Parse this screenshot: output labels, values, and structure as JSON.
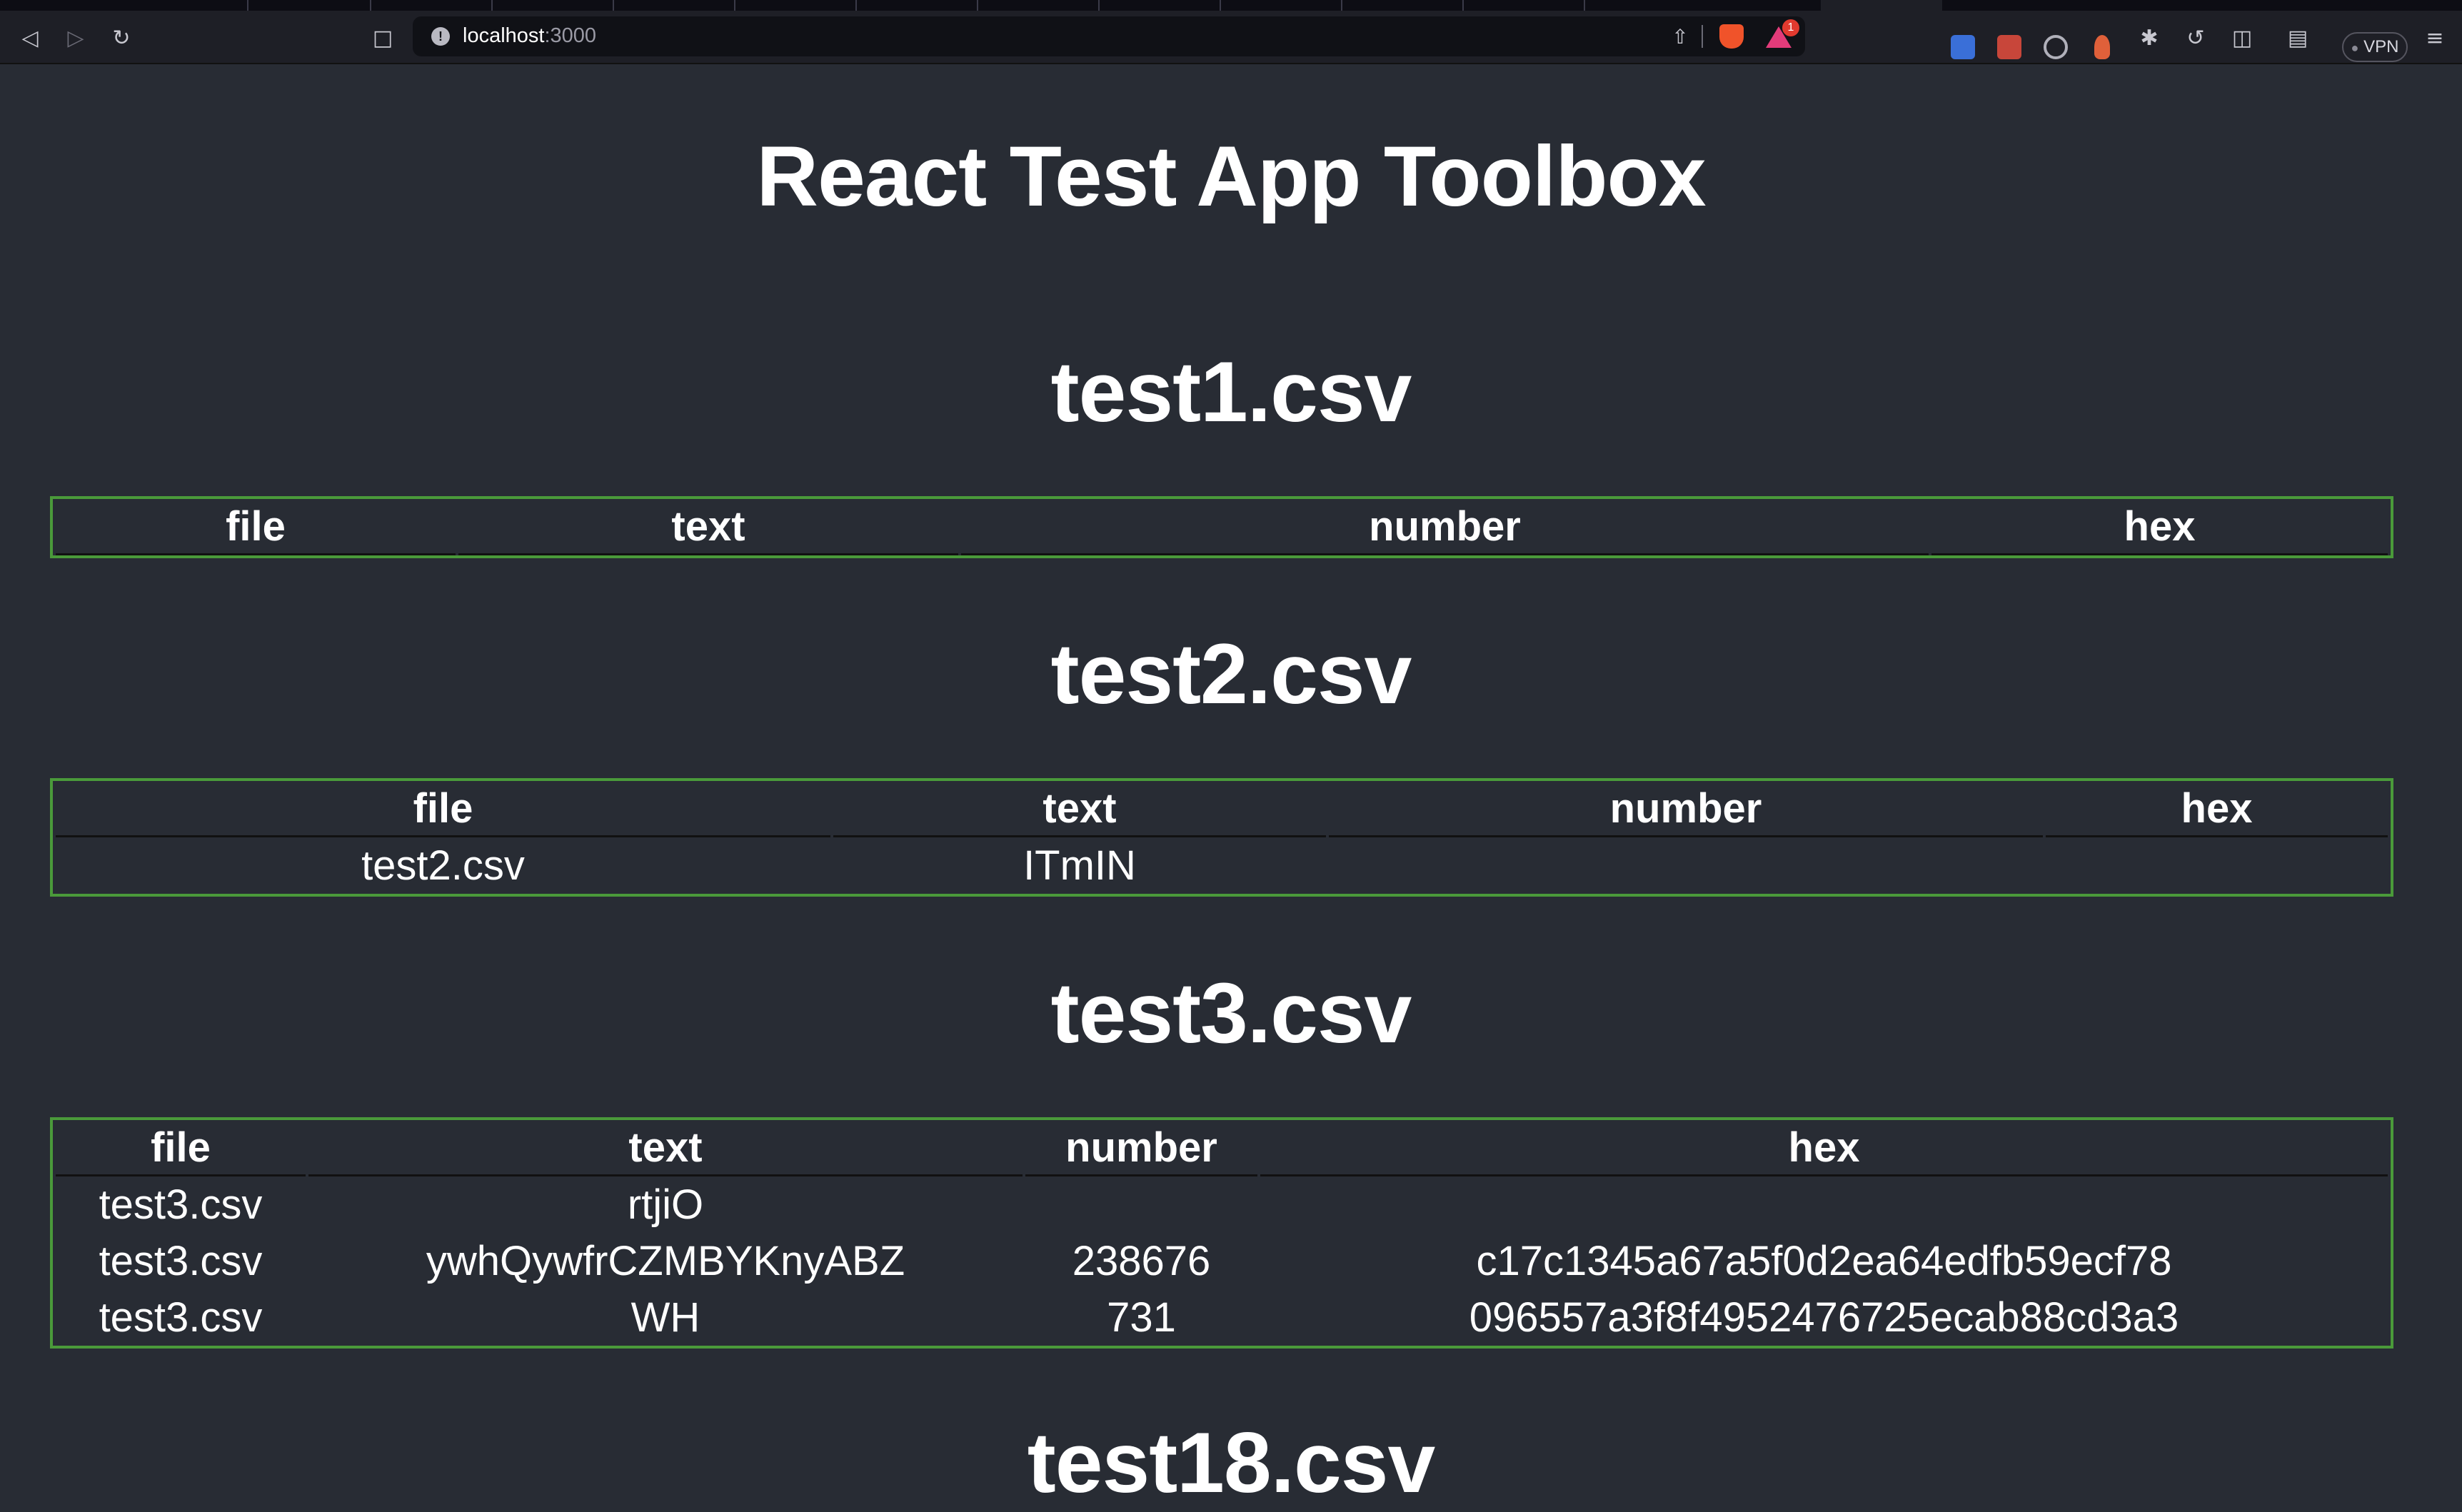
{
  "browser": {
    "url_host": "localhost",
    "url_port": ":3000",
    "notification_count": "1",
    "vpn_label": "VPN",
    "icons": [
      "back-icon",
      "forward-icon",
      "reload-icon",
      "bookmark-icon",
      "site-info-icon",
      "share-icon",
      "brave-shields-icon",
      "brave-rewards-icon",
      "extension-translate-icon",
      "extension-red-icon",
      "extension-target-icon",
      "extension-person-icon",
      "extensions-puzzle-icon",
      "sync-icon",
      "sidebar-icon",
      "wallet-icon",
      "menu-icon"
    ]
  },
  "page": {
    "title": "React Test App Toolbox"
  },
  "tables": [
    {
      "file_title": "test1.csv",
      "headers": [
        "file",
        "text",
        "number",
        "hex"
      ],
      "rows": []
    },
    {
      "file_title": "test2.csv",
      "headers": [
        "file",
        "text",
        "number",
        "hex"
      ],
      "rows": [
        [
          "test2.csv",
          "ITmIN",
          "",
          ""
        ]
      ]
    },
    {
      "file_title": "test3.csv",
      "headers": [
        "file",
        "text",
        "number",
        "hex"
      ],
      "rows": [
        [
          "test3.csv",
          "rtjiO",
          "",
          ""
        ],
        [
          "test3.csv",
          "ywhQywfrCZMBYKnyABZ",
          "238676",
          "c17c1345a67a5f0d2ea64edfb59ecf78"
        ],
        [
          "test3.csv",
          "WH",
          "731",
          "096557a3f8f4952476725ecab88cd3a3"
        ]
      ]
    },
    {
      "file_title": "test18.csv"
    }
  ],
  "colors": {
    "background": "#282c34",
    "table_border": "#4a9a3a",
    "text": "#ffffff"
  }
}
